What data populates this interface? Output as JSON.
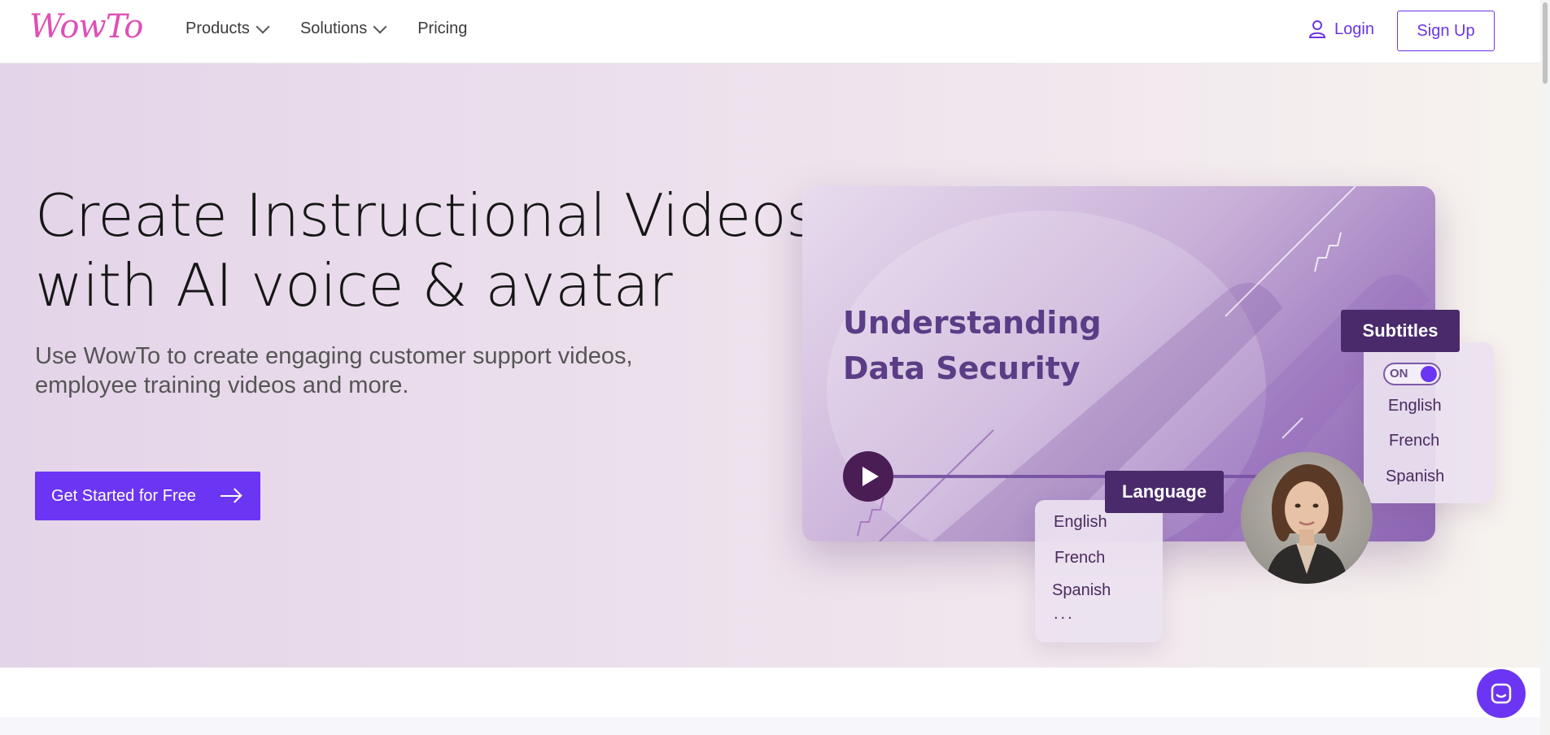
{
  "header": {
    "logo": "WowTo",
    "nav": [
      {
        "label": "Products"
      },
      {
        "label": "Solutions"
      },
      {
        "label": "Pricing"
      }
    ],
    "login_label": "Login",
    "signup_label": "Sign Up"
  },
  "hero": {
    "headline_line1": "Create Instructional Videos",
    "headline_line2": "with AI voice & avatar",
    "sub_line1": "Use WowTo to create engaging customer support videos,",
    "sub_line2": "employee training videos and more.",
    "cta_label": "Get Started for Free"
  },
  "video": {
    "title_line1": "Understanding",
    "title_line2": "Data Security",
    "subtitles": {
      "title": "Subtitles",
      "toggle_label": "ON",
      "options": [
        "English",
        "French",
        "Spanish"
      ]
    },
    "language": {
      "title": "Language",
      "options": [
        "English",
        "French",
        "Spanish"
      ],
      "more": "..."
    }
  },
  "colors": {
    "accent": "#6b35f3",
    "logo": "#e04fb6",
    "panel_title": "#4a2a6b"
  }
}
